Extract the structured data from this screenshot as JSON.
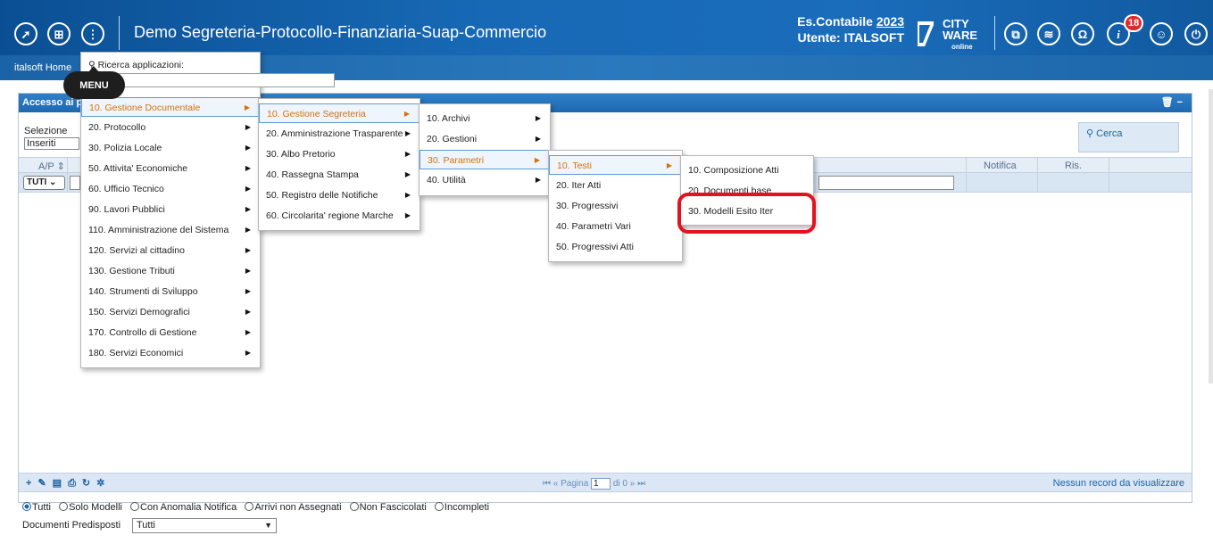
{
  "header": {
    "title": "Demo Segreteria-Protocollo-Finanziaria-Suap-Commercio",
    "es_label": "Es.Contabile",
    "es_year": "2023",
    "user_label": "Utente: ITALSOFT",
    "logo_line1": "CITY",
    "logo_line2": "WARE",
    "logo_line3": "online",
    "notification_count": "18",
    "colors": {
      "bar": "#1769b5",
      "badge": "#e02a2a",
      "accent": "#d6700a"
    }
  },
  "tabbar": {
    "home": "italsoft Home"
  },
  "tooltip": {
    "label": "MENU"
  },
  "panel": {
    "title": "Accesso ai p",
    "selection_label": "Selezione",
    "selection_value": "Inseriti",
    "search_button": "Cerca",
    "columns": {
      "ap": "A/P",
      "notifica": "Notifica",
      "ris": "Ris."
    },
    "filter_value": "TUTI",
    "pager": {
      "page_label": "Pagina",
      "page_value": "1",
      "of_label": "di 0",
      "empty_text": "Nessun record da visualizzare"
    }
  },
  "radios": [
    {
      "label": "Tutti",
      "checked": true
    },
    {
      "label": "Solo Modelli",
      "checked": false
    },
    {
      "label": "Con Anomalia Notifica",
      "checked": false
    },
    {
      "label": "Arrivi non Assegnati",
      "checked": false
    },
    {
      "label": "Non Fascicolati",
      "checked": false
    },
    {
      "label": "Incompleti",
      "checked": false
    }
  ],
  "doc_predisposti": {
    "label": "Documenti Predisposti",
    "value": "Tutti"
  },
  "menu": {
    "search_label": "Ricerca applicazioni:",
    "level1": [
      "10. Gestione Documentale",
      "20. Protocollo",
      "30. Polizia Locale",
      "50. Attivita' Economiche",
      "60. Ufficio Tecnico",
      "90. Lavori Pubblici",
      "110. Amministrazione del Sistema",
      "120. Servizi al cittadino",
      "130. Gestione Tributi",
      "140. Strumenti di Sviluppo",
      "150. Servizi Demografici",
      "170. Controllo di Gestione",
      "180. Servizi Economici"
    ],
    "level2": [
      "10. Gestione Segreteria",
      "20. Amministrazione Trasparente",
      "30. Albo Pretorio",
      "40. Rassegna Stampa",
      "50. Registro delle Notifiche",
      "60. Circolarita' regione Marche"
    ],
    "level3": [
      "10. Archivi",
      "20. Gestioni",
      "30. Parametri",
      "40. Utilità"
    ],
    "level4": [
      "10. Testi",
      "20. Iter Atti",
      "30. Progressivi",
      "40. Parametri Vari",
      "50. Progressivi Atti"
    ],
    "level5": [
      "10. Composizione Atti",
      "20. Documenti base",
      "30. Modelli Esito Iter"
    ]
  }
}
